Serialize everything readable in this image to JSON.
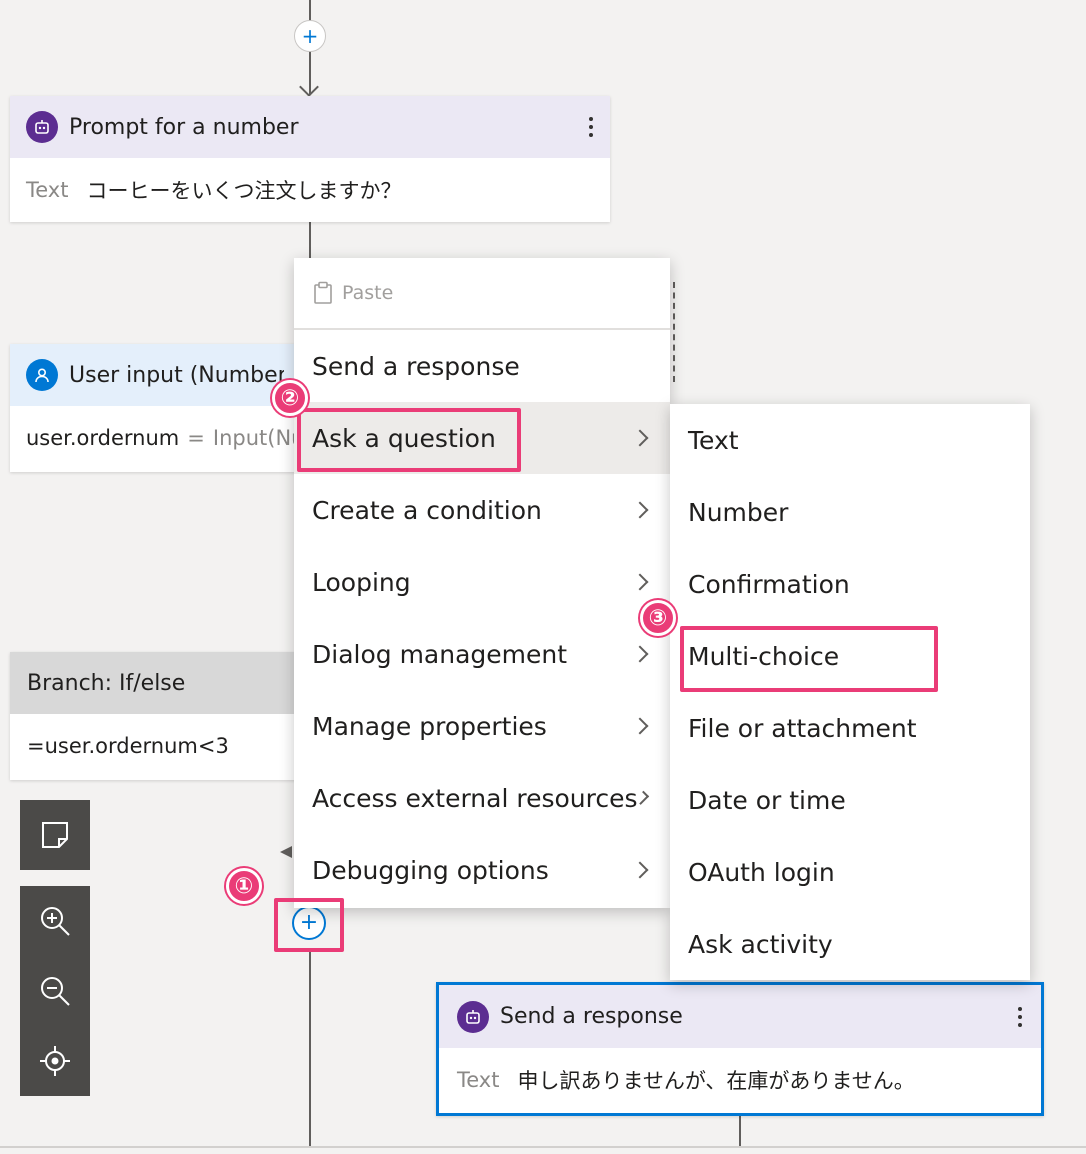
{
  "cards": {
    "prompt": {
      "title": "Prompt for a number",
      "field": "Text",
      "value": "コーヒーをいくつ注文しますか？"
    },
    "user_input": {
      "title": "User input (Number)",
      "property": "user.ordernum",
      "equals": "=",
      "value": "Input(Nu"
    },
    "branch": {
      "title": "Branch: If/else",
      "condition": "=user.ordernum<3"
    },
    "send_response": {
      "title": "Send a response",
      "field": "Text",
      "value": "申し訳ありませんが、在庫がありません。"
    }
  },
  "menu": {
    "paste": "Paste",
    "items": [
      {
        "label": "Send a response"
      },
      {
        "label": "Ask a question"
      },
      {
        "label": "Create a condition"
      },
      {
        "label": "Looping"
      },
      {
        "label": "Dialog management"
      },
      {
        "label": "Manage properties"
      },
      {
        "label": "Access external resources"
      },
      {
        "label": "Debugging options"
      }
    ]
  },
  "submenu": {
    "items": [
      {
        "label": "Text"
      },
      {
        "label": "Number"
      },
      {
        "label": "Confirmation"
      },
      {
        "label": "Multi-choice"
      },
      {
        "label": "File or attachment"
      },
      {
        "label": "Date or time"
      },
      {
        "label": "OAuth login"
      },
      {
        "label": "Ask activity"
      }
    ]
  },
  "annotations": {
    "step1": "①",
    "step2": "②",
    "step3": "③"
  },
  "plus": "+",
  "colors": {
    "bot_icon": "#5c2d91",
    "user_icon": "#0078d4",
    "highlight": "#ea3c77",
    "bot_header": "#ebe8f4",
    "user_header": "#e4effb",
    "branch_header": "#d8d8d8"
  },
  "icons": [
    "bot-icon",
    "user-icon",
    "paste-icon",
    "chevron-right-icon",
    "add-comment-icon",
    "zoom-in-icon",
    "zoom-out-icon",
    "recenter-icon"
  ]
}
